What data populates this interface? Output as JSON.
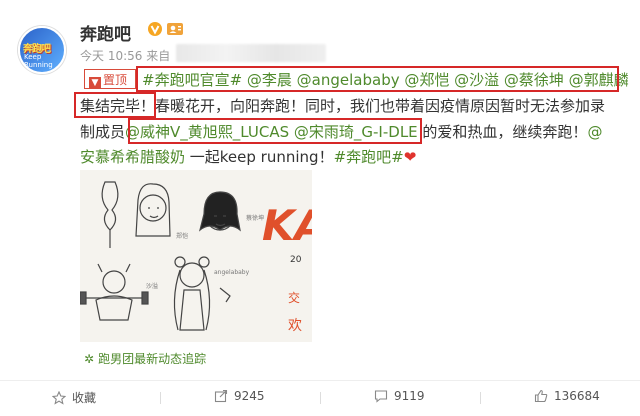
{
  "post": {
    "username": "奔跑吧",
    "verified_icon": "verified-v-icon",
    "avatar_text_top": "奔跑吧",
    "avatar_text_bottom": "Keep Running",
    "timestamp": "今天 10:56 来自",
    "pinned_label": "置顶",
    "line1": [
      "#奔跑吧官宣#",
      " @李晨 @angelababy @郑恺 @沙溢 @蔡徐坤 @郭麒麟"
    ],
    "line2_pre": "集结完毕",
    "line2_rest": "！春暖花开，向阳奔跑！同时，我们也带着因疫情原因暂时无法参加录",
    "line3_pre": "制成员",
    "line3_mention": "@威神V_黄旭熙_LUCAS @宋雨琦_G-I-DLE",
    "line3_rest": " 的爱和热血，继续奔跑！",
    "line3_tail": "@",
    "line4_mention": "安慕希希腊酸奶",
    "line4_mid": " 一起keep running！",
    "line4_tag": "#奔跑吧#",
    "heart": "❤",
    "image_text": {
      "ka": "KA",
      "num": "20",
      "jiao": "交",
      "huan": "欢"
    },
    "feed_link": "跑男团最新动态追踪"
  },
  "actions": {
    "collect": "收藏",
    "share": "9245",
    "comment": "9119",
    "like": "136684"
  },
  "colors": {
    "link": "#4f8a2c",
    "highlight": "#d62828",
    "pin": "#d84b3a"
  }
}
